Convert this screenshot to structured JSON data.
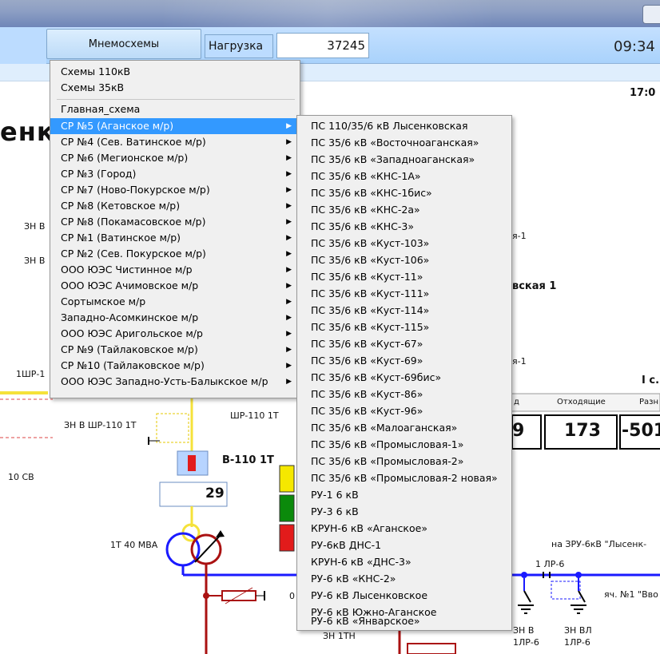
{
  "toolbar": {
    "mnemo_button": "Мнемосхемы",
    "load_label": "Нагрузка",
    "load_value": "37245",
    "clock": "09:34"
  },
  "background": {
    "time2": "17:0",
    "title_fragment": "енк",
    "zn_b_1": "ЗН В",
    "zn_b_2": "ЗН В",
    "shr_left": "1ШР-1",
    "cb_10": "10 СВ",
    "zn_shr": "ЗН В ШР-110 1Т",
    "shr_110": "ШР-110 1Т",
    "v110": "В-110 1Т",
    "v110_value": "29",
    "t1": "1Т 40 МВА",
    "a1": "я-1",
    "a2": "вская 1",
    "a3": "я-1",
    "i_c": "I с.",
    "col_d": "д",
    "col_out": "Отходящие",
    "col_diff": "Разн",
    "val_9": "9",
    "val_173": "173",
    "val_501": "-501",
    "zru": "на ЗРУ-6кВ \"Лысенк-",
    "lr6": "1 ЛР-6",
    "yach1": "яч. №1 \"Вво",
    "zn_v": "ЗН В",
    "zn_vl": "ЗН ВЛ",
    "lr6_a": "1ЛР-6",
    "lr6_b": "1ЛР-6",
    "zn_1tn": "ЗН 1ТН",
    "zero": "0"
  },
  "menu": {
    "items": [
      {
        "label": "Схемы 110кВ",
        "submenu": false
      },
      {
        "label": "Схемы 35кВ",
        "submenu": false
      },
      {
        "label": "Главная_схема",
        "submenu": false
      },
      {
        "label": "СР №5 (Аганское м/р)",
        "submenu": true,
        "highlighted": true
      },
      {
        "label": "СР №4 (Сев. Ватинское м/р)",
        "submenu": true
      },
      {
        "label": "СР №6 (Мегионское м/р)",
        "submenu": true
      },
      {
        "label": "СР №3 (Город)",
        "submenu": true
      },
      {
        "label": "СР №7 (Ново-Покурское м/р)",
        "submenu": true
      },
      {
        "label": "СР №8 (Кетовское м/р)",
        "submenu": true
      },
      {
        "label": "СР №8 (Покамасовское м/р)",
        "submenu": true
      },
      {
        "label": "СР №1 (Ватинское м/р)",
        "submenu": true
      },
      {
        "label": "СР №2 (Сев. Покурское м/р)",
        "submenu": true
      },
      {
        "label": "ООО ЮЭС Чистинное м/р",
        "submenu": true
      },
      {
        "label": "ООО ЮЭС Ачимовское м/р",
        "submenu": true
      },
      {
        "label": "Сортымское м/р",
        "submenu": true
      },
      {
        "label": "Западно-Асомкинское м/р",
        "submenu": true
      },
      {
        "label": "ООО ЮЭС Аригольское м/р",
        "submenu": true
      },
      {
        "label": "СР №9 (Тайлаковское м/р)",
        "submenu": true
      },
      {
        "label": "СР №10 (Тайлаковское м/р)",
        "submenu": true
      },
      {
        "label": "ООО ЮЭС Западно-Усть-Балыкское м/р",
        "submenu": true
      }
    ],
    "arrow": "▶"
  },
  "submenu": {
    "items": [
      "ПС 110/35/6 кВ Лысенковская",
      "ПС 35/6 кВ «Восточноаганская»",
      "ПС 35/6 кВ «Западноаганская»",
      "ПС 35/6 кВ «КНС-1А»",
      "ПС 35/6 кВ «КНС-1бис»",
      "ПС 35/6 кВ «КНС-2а»",
      "ПС 35/6 кВ «КНС-3»",
      "ПС 35/6 кВ «Куст-103»",
      "ПС 35/6 кВ «Куст-106»",
      "ПС 35/6 кВ «Куст-11»",
      "ПС 35/6 кВ «Куст-111»",
      "ПС 35/6 кВ «Куст-114»",
      "ПС 35/6 кВ «Куст-115»",
      "ПС 35/6 кВ «Куст-67»",
      "ПС 35/6 кВ «Куст-69»",
      "ПС 35/6 кВ «Куст-69бис»",
      "ПС 35/6 кВ «Куст-86»",
      "ПС 35/6 кВ «Куст-96»",
      "ПС 35/6 кВ «Малоаганская»",
      "ПС 35/6 кВ «Промысловая-1»",
      "ПС 35/6 кВ «Промысловая-2»",
      "ПС 35/6 кВ «Промысловая-2 новая»",
      "РУ-1 6 кВ",
      "РУ-3 6 кВ",
      "КРУН-6 кВ «Аганское»",
      "РУ-6кВ ДНС-1",
      "КРУН-6 кВ «ДНС-3»",
      "РУ-6 кВ «КНС-2»",
      "РУ-6 кВ Лысенковское",
      "РУ-6 кВ Южно-Аганское",
      "РУ-6 кВ «Январское»"
    ]
  },
  "colors": {
    "highlight": "#3399ff",
    "bus_blue": "#1a1aff",
    "bus_red": "#aa1111",
    "bus_yellow": "#f5e23a"
  }
}
